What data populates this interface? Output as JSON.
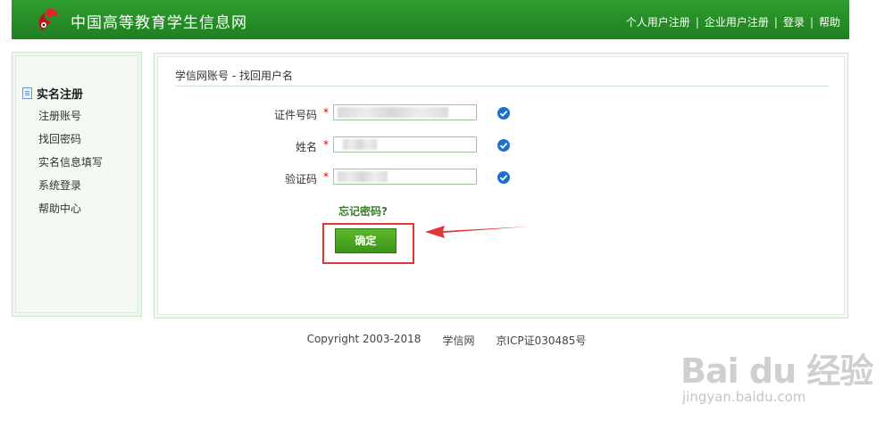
{
  "header": {
    "site_title": "中国高等教育学生信息网",
    "nav": [
      "个人用户注册",
      "企业用户注册",
      "登录",
      "帮助"
    ],
    "separator": "|"
  },
  "sidebar": {
    "heading": "实名注册",
    "items": [
      "注册账号",
      "找回密码",
      "实名信息填写",
      "系统登录",
      "帮助中心"
    ]
  },
  "main": {
    "breadcrumb": "学信网账号 - 找回用户名",
    "form": {
      "fields": [
        {
          "label": "证件号码",
          "required_mark": "*",
          "value": "",
          "status_icon": "check-circle-icon"
        },
        {
          "label": "姓名",
          "required_mark": "*",
          "value": "",
          "status_icon": "check-circle-icon"
        },
        {
          "label": "验证码",
          "required_mark": "*",
          "value": "",
          "status_icon": "check-circle-icon"
        }
      ],
      "forgot_password_link": "忘记密码?",
      "submit_label": "确定"
    }
  },
  "footer": {
    "copyright": "Copyright 2003-2018",
    "site": "学信网",
    "icp": "京ICP证030485号"
  },
  "watermark": {
    "brand": "Bai du 经验",
    "domain": "jingyan.baidu.com"
  },
  "colors": {
    "header_green": "#2a922a",
    "accent_blue": "#1d6fd0",
    "required_red": "#dd0000",
    "highlight_red": "#e33535",
    "button_green": "#4aa520"
  }
}
